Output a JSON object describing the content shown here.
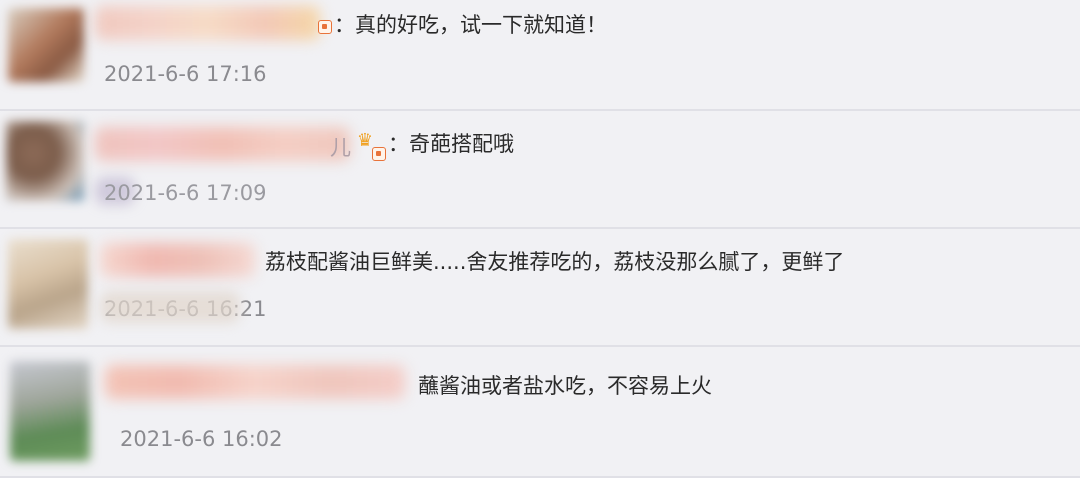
{
  "comments": [
    {
      "text": "：真的好吃，试一下就知道！",
      "timestamp": "2021-6-6 17:16",
      "badges": [
        "member-badge-icon"
      ]
    },
    {
      "name_fragment": "儿",
      "text": "：奇葩搭配哦",
      "timestamp": "2021-6-6 17:09",
      "badges": [
        "crown-icon",
        "member-badge-icon"
      ]
    },
    {
      "text": "荔枝配酱油巨鲜美.....舍友推荐吃的，荔枝没那么腻了，更鲜了",
      "timestamp": "2021-6-6 16:21"
    },
    {
      "text": "蘸酱油或者盐水吃，不容易上火",
      "timestamp": "2021-6-6 16:02"
    }
  ],
  "colors": {
    "background": "#f1f1f4",
    "text": "#2a2a2a",
    "timestamp": "#8a8a8f",
    "badge": "#e8733a"
  }
}
